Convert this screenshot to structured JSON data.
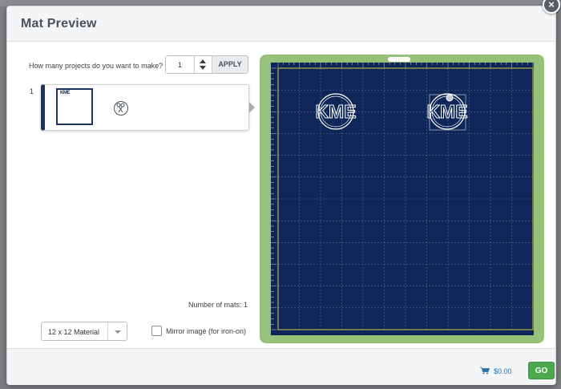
{
  "dialog": {
    "title": "Mat Preview",
    "close_icon": "close-icon"
  },
  "projects": {
    "question": "How many projects do you want to make?",
    "quantity": "1",
    "apply_label": "APPLY"
  },
  "mats": [
    {
      "index": "1",
      "thumb_text": "KME",
      "cut_icon": "cut-scissors-icon"
    }
  ],
  "summary": {
    "num_mats_label": "Number of mats:",
    "num_mats_value": "1"
  },
  "material": {
    "selected": "12 x 12 Material"
  },
  "mirror": {
    "label": "Mirror image (for iron-on)",
    "checked": false
  },
  "preview": {
    "monograms": [
      "KME",
      "KME"
    ],
    "mat_color": "#0e2658",
    "frame_color": "#97c17a"
  },
  "footer": {
    "price": "$0.00",
    "go_label": "GO",
    "cart_icon": "cart-icon"
  }
}
